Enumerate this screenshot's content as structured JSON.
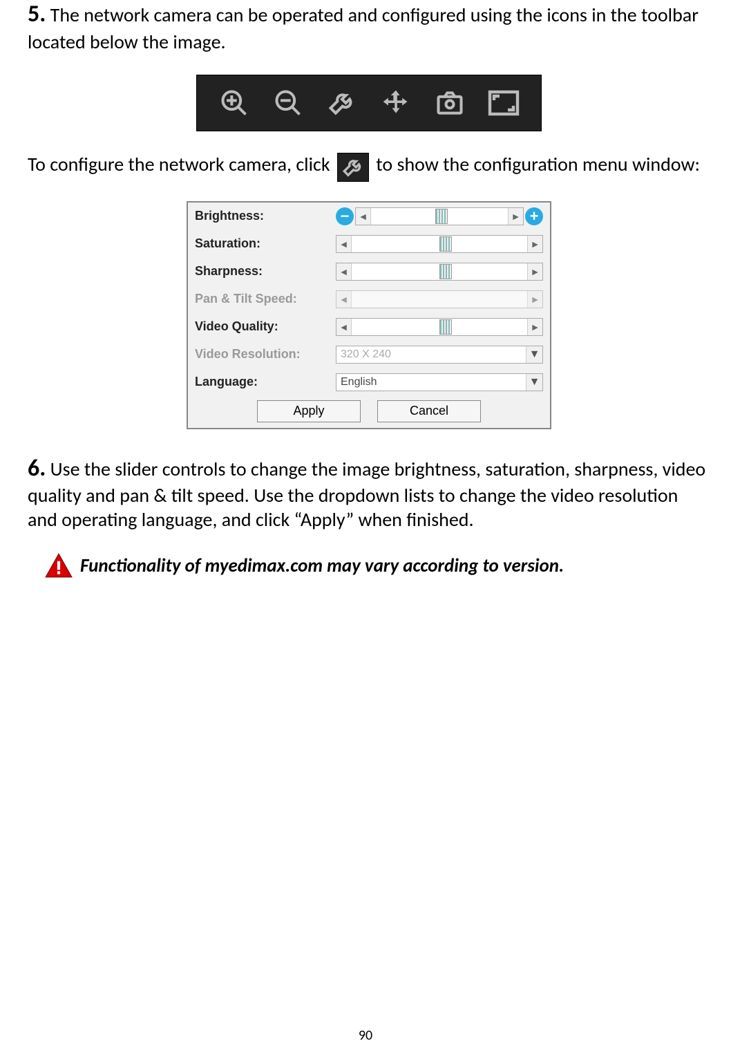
{
  "step5": {
    "num": "5.",
    "text": "The network camera can be operated and configured using the icons in the toolbar located below the image."
  },
  "toolbar_icons": [
    "zoom-in",
    "zoom-out",
    "wrench",
    "move",
    "camera",
    "fullscreen"
  ],
  "config_sentence": {
    "before": "To configure the network camera, click",
    "after": "to show the configuration menu window:"
  },
  "config_panel": {
    "rows": [
      {
        "label": "Brightness:",
        "type": "slider",
        "disabled": false,
        "thumb_pct": 47,
        "decorated": true
      },
      {
        "label": "Saturation:",
        "type": "slider",
        "disabled": false,
        "thumb_pct": 50
      },
      {
        "label": "Sharpness:",
        "type": "slider",
        "disabled": false,
        "thumb_pct": 50
      },
      {
        "label": "Pan & Tilt Speed:",
        "type": "slider",
        "disabled": true,
        "thumb_pct": 0
      },
      {
        "label": "Video Quality:",
        "type": "slider",
        "disabled": false,
        "thumb_pct": 50
      },
      {
        "label": "Video Resolution:",
        "type": "select",
        "disabled": true,
        "value": "320 X 240"
      },
      {
        "label": "Language:",
        "type": "select",
        "disabled": false,
        "value": "English"
      }
    ],
    "apply": "Apply",
    "cancel": "Cancel"
  },
  "step6": {
    "num": "6.",
    "text": "Use the slider controls to change the image brightness, saturation, sharpness, video quality and pan & tilt speed. Use the dropdown lists to change the video resolution and operating language, and click “Apply” when finished."
  },
  "note": "Functionality of myedimax.com may vary according to version.",
  "page_number": "90"
}
